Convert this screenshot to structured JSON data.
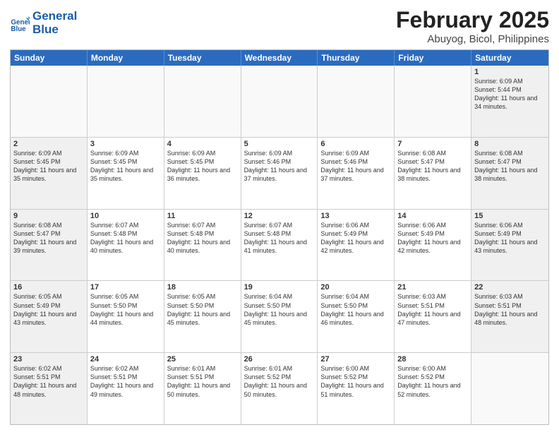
{
  "header": {
    "logo_line1": "General",
    "logo_line2": "Blue",
    "title": "February 2025",
    "subtitle": "Abuyog, Bicol, Philippines"
  },
  "days_of_week": [
    "Sunday",
    "Monday",
    "Tuesday",
    "Wednesday",
    "Thursday",
    "Friday",
    "Saturday"
  ],
  "weeks": [
    [
      {
        "day": "",
        "info": "",
        "empty": true
      },
      {
        "day": "",
        "info": "",
        "empty": true
      },
      {
        "day": "",
        "info": "",
        "empty": true
      },
      {
        "day": "",
        "info": "",
        "empty": true
      },
      {
        "day": "",
        "info": "",
        "empty": true
      },
      {
        "day": "",
        "info": "",
        "empty": true
      },
      {
        "day": "1",
        "info": "Sunrise: 6:09 AM\nSunset: 5:44 PM\nDaylight: 11 hours and 34 minutes."
      }
    ],
    [
      {
        "day": "2",
        "info": "Sunrise: 6:09 AM\nSunset: 5:45 PM\nDaylight: 11 hours and 35 minutes."
      },
      {
        "day": "3",
        "info": "Sunrise: 6:09 AM\nSunset: 5:45 PM\nDaylight: 11 hours and 35 minutes."
      },
      {
        "day": "4",
        "info": "Sunrise: 6:09 AM\nSunset: 5:45 PM\nDaylight: 11 hours and 36 minutes."
      },
      {
        "day": "5",
        "info": "Sunrise: 6:09 AM\nSunset: 5:46 PM\nDaylight: 11 hours and 37 minutes."
      },
      {
        "day": "6",
        "info": "Sunrise: 6:09 AM\nSunset: 5:46 PM\nDaylight: 11 hours and 37 minutes."
      },
      {
        "day": "7",
        "info": "Sunrise: 6:08 AM\nSunset: 5:47 PM\nDaylight: 11 hours and 38 minutes."
      },
      {
        "day": "8",
        "info": "Sunrise: 6:08 AM\nSunset: 5:47 PM\nDaylight: 11 hours and 38 minutes."
      }
    ],
    [
      {
        "day": "9",
        "info": "Sunrise: 6:08 AM\nSunset: 5:47 PM\nDaylight: 11 hours and 39 minutes."
      },
      {
        "day": "10",
        "info": "Sunrise: 6:07 AM\nSunset: 5:48 PM\nDaylight: 11 hours and 40 minutes."
      },
      {
        "day": "11",
        "info": "Sunrise: 6:07 AM\nSunset: 5:48 PM\nDaylight: 11 hours and 40 minutes."
      },
      {
        "day": "12",
        "info": "Sunrise: 6:07 AM\nSunset: 5:48 PM\nDaylight: 11 hours and 41 minutes."
      },
      {
        "day": "13",
        "info": "Sunrise: 6:06 AM\nSunset: 5:49 PM\nDaylight: 11 hours and 42 minutes."
      },
      {
        "day": "14",
        "info": "Sunrise: 6:06 AM\nSunset: 5:49 PM\nDaylight: 11 hours and 42 minutes."
      },
      {
        "day": "15",
        "info": "Sunrise: 6:06 AM\nSunset: 5:49 PM\nDaylight: 11 hours and 43 minutes."
      }
    ],
    [
      {
        "day": "16",
        "info": "Sunrise: 6:05 AM\nSunset: 5:49 PM\nDaylight: 11 hours and 43 minutes."
      },
      {
        "day": "17",
        "info": "Sunrise: 6:05 AM\nSunset: 5:50 PM\nDaylight: 11 hours and 44 minutes."
      },
      {
        "day": "18",
        "info": "Sunrise: 6:05 AM\nSunset: 5:50 PM\nDaylight: 11 hours and 45 minutes."
      },
      {
        "day": "19",
        "info": "Sunrise: 6:04 AM\nSunset: 5:50 PM\nDaylight: 11 hours and 45 minutes."
      },
      {
        "day": "20",
        "info": "Sunrise: 6:04 AM\nSunset: 5:50 PM\nDaylight: 11 hours and 46 minutes."
      },
      {
        "day": "21",
        "info": "Sunrise: 6:03 AM\nSunset: 5:51 PM\nDaylight: 11 hours and 47 minutes."
      },
      {
        "day": "22",
        "info": "Sunrise: 6:03 AM\nSunset: 5:51 PM\nDaylight: 11 hours and 48 minutes."
      }
    ],
    [
      {
        "day": "23",
        "info": "Sunrise: 6:02 AM\nSunset: 5:51 PM\nDaylight: 11 hours and 48 minutes."
      },
      {
        "day": "24",
        "info": "Sunrise: 6:02 AM\nSunset: 5:51 PM\nDaylight: 11 hours and 49 minutes."
      },
      {
        "day": "25",
        "info": "Sunrise: 6:01 AM\nSunset: 5:51 PM\nDaylight: 11 hours and 50 minutes."
      },
      {
        "day": "26",
        "info": "Sunrise: 6:01 AM\nSunset: 5:52 PM\nDaylight: 11 hours and 50 minutes."
      },
      {
        "day": "27",
        "info": "Sunrise: 6:00 AM\nSunset: 5:52 PM\nDaylight: 11 hours and 51 minutes."
      },
      {
        "day": "28",
        "info": "Sunrise: 6:00 AM\nSunset: 5:52 PM\nDaylight: 11 hours and 52 minutes."
      },
      {
        "day": "",
        "info": "",
        "empty": true
      }
    ]
  ]
}
